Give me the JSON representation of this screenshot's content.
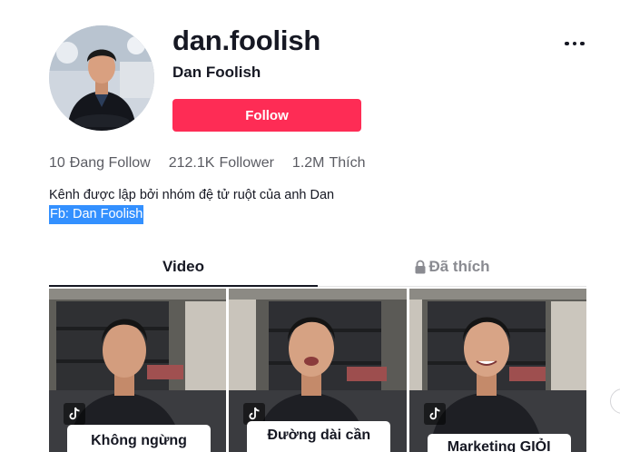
{
  "profile": {
    "username": "dan.foolish",
    "nickname": "Dan Foolish",
    "follow_label": "Follow",
    "more_icon": "more-horizontal-icon"
  },
  "stats": [
    {
      "value": "10",
      "label": "Đang Follow"
    },
    {
      "value": "212.1K",
      "label": "Follower"
    },
    {
      "value": "1.2M",
      "label": "Thích"
    }
  ],
  "bio": {
    "text": "Kênh được lập bởi nhóm đệ tử ruột của anh Dan",
    "link": "Fb: Dan Foolish"
  },
  "tabs": {
    "video": "Video",
    "liked": "Đã thích",
    "liked_icon": "lock-icon"
  },
  "videos": [
    {
      "caption": "Không ngừng"
    },
    {
      "caption": "Đường dài cần"
    },
    {
      "caption": "Marketing GIỎI"
    }
  ],
  "colors": {
    "accent": "#fe2c55",
    "selection": "#3390ff",
    "text": "#161823",
    "muted": "#8a8b91"
  }
}
